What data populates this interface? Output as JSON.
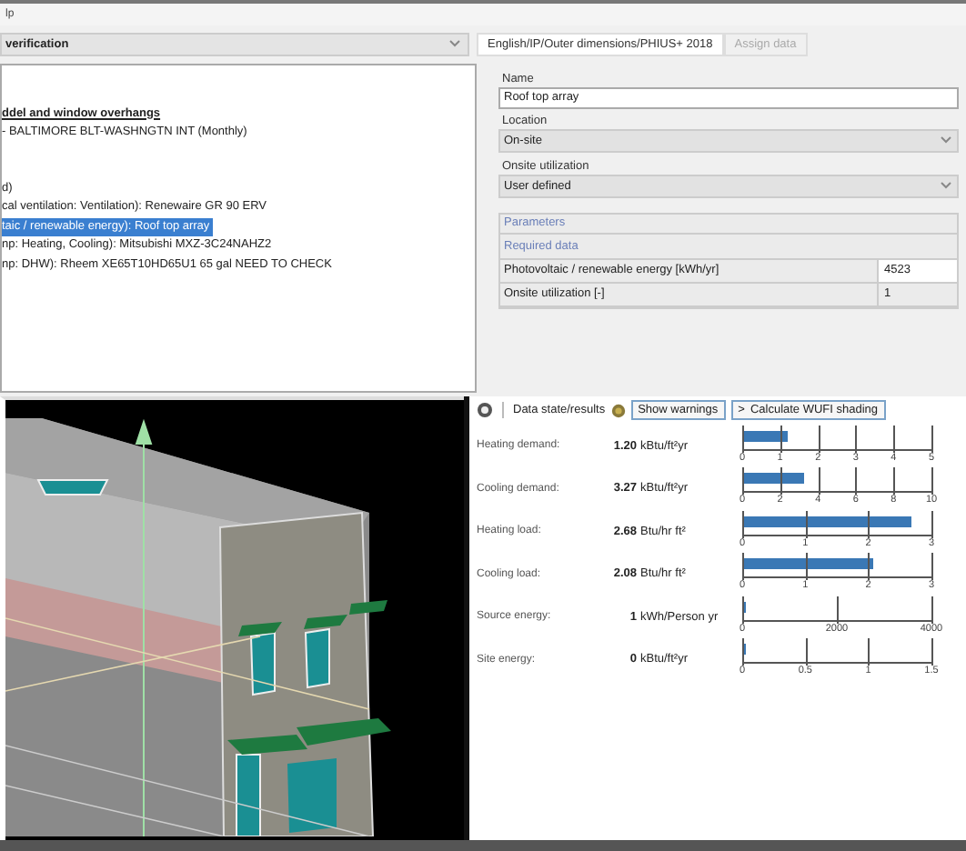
{
  "menu": {
    "label": "lp"
  },
  "mode_dropdown": {
    "value": "verification"
  },
  "tabs": [
    {
      "label": "English/IP/Outer dimensions/PHIUS+ 2018",
      "selected": true
    },
    {
      "label": "Assign data",
      "selected": false
    }
  ],
  "tree": {
    "items": [
      {
        "kind": "heading",
        "label": "ddel and window overhangs",
        "selected": false
      },
      {
        "kind": "item",
        "label": "- BALTIMORE BLT-WASHNGTN INT  (Monthly)",
        "selected": false
      },
      {
        "kind": "gap"
      },
      {
        "kind": "item",
        "label": "d)",
        "selected": false
      },
      {
        "kind": "item",
        "label": "cal ventilation: Ventilation): Renewaire GR 90 ERV",
        "selected": false
      },
      {
        "kind": "item",
        "label": "taic / renewable energy): Roof top array",
        "selected": true
      },
      {
        "kind": "item",
        "label": "np: Heating, Cooling): Mitsubishi MXZ-3C24NAHZ2",
        "selected": false
      },
      {
        "kind": "item",
        "label": "np: DHW): Rheem XE65T10HD65U1 65 gal NEED TO CHECK",
        "selected": false
      }
    ]
  },
  "form": {
    "name_label": "Name",
    "name_value": "Roof top array",
    "location_label": "Location",
    "location_value": "On-site",
    "utilization_label": "Onsite utilization",
    "utilization_value": "User defined",
    "parameters_label": "Parameters",
    "required_label": "Required data",
    "rows": [
      {
        "label": "Photovoltaic / renewable energy  [kWh/yr]",
        "value": "4523",
        "editable": true
      },
      {
        "label": "Onsite utilization  [-]",
        "value": "1",
        "editable": false
      }
    ]
  },
  "results": {
    "tab_label": "Data state/results",
    "warnings_button": "Show warnings",
    "shading_button": "Calculate WUFI shading",
    "shading_arrow": ">",
    "rows": [
      {
        "label": "Heating demand:",
        "value": "1.20",
        "unit": "kBtu/ft²yr",
        "level": 0.24,
        "scale": [
          "0",
          "1",
          "2",
          "3",
          "4",
          "5"
        ]
      },
      {
        "label": "Cooling demand:",
        "value": "3.27",
        "unit": "kBtu/ft²yr",
        "level": 0.327,
        "scale": [
          "0",
          "2",
          "4",
          "6",
          "8",
          "10"
        ]
      },
      {
        "label": "Heating load:",
        "value": "2.68",
        "unit": "Btu/hr ft²",
        "level": 0.893,
        "scale": [
          "0",
          "1",
          "2",
          "3"
        ]
      },
      {
        "label": "Cooling load:",
        "value": "2.08",
        "unit": "Btu/hr ft²",
        "level": 0.693,
        "scale": [
          "0",
          "1",
          "2",
          "3"
        ]
      },
      {
        "label": "Source energy:",
        "value": "1",
        "unit": "kWh/Person yr",
        "level": 0,
        "scale": [
          "0",
          "2000",
          "4000"
        ]
      },
      {
        "label": "Site energy:",
        "value": "0",
        "unit": "kBtu/ft²yr",
        "level": 0,
        "scale": [
          "0",
          "0.5",
          "1",
          "1.5"
        ]
      }
    ]
  }
}
